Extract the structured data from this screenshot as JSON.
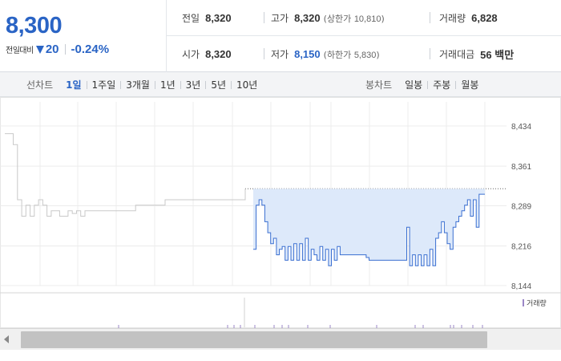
{
  "summary": {
    "current_price": "8,300",
    "change_label": "전일대비",
    "change_direction": "down",
    "change_amount": "20",
    "change_percent": "-0.24%",
    "down_color": "#2a64c5",
    "stats": {
      "prev_close": {
        "label": "전일",
        "value": "8,320"
      },
      "open": {
        "label": "시가",
        "value": "8,320"
      },
      "high": {
        "label": "고가",
        "value": "8,320",
        "limit_label": "상한가",
        "limit_value": "10,810"
      },
      "low": {
        "label": "저가",
        "value": "8,150",
        "limit_label": "하한가",
        "limit_value": "5,830"
      },
      "volume": {
        "label": "거래량",
        "value": "6,828"
      },
      "trade_value": {
        "label": "거래대금",
        "value": "56 백만"
      }
    }
  },
  "toolbar": {
    "line_chart_title": "선차트",
    "periods": [
      "1일",
      "1주일",
      "3개월",
      "1년",
      "3년",
      "5년",
      "10년"
    ],
    "active_period": "1일",
    "candle_chart_title": "봉차트",
    "candle_periods": [
      "일봉",
      "주봉",
      "월봉"
    ]
  },
  "chart_data": {
    "type": "line",
    "y_ticks": [
      "8,434",
      "8,361",
      "8,289",
      "8,216",
      "8,144"
    ],
    "ylim": [
      8144,
      8434
    ],
    "reference_line": 8320,
    "grid": true,
    "legend": "거래량",
    "series": [
      {
        "color": "#c9c9c9",
        "values": [
          8420,
          8420,
          8400,
          8300,
          8270,
          8290,
          8270,
          8290,
          8300,
          8290,
          8270,
          8280,
          8280,
          8270,
          8270,
          8280,
          8275,
          8280,
          8270,
          8280,
          8280,
          8280,
          8280,
          8280,
          8280,
          8280,
          8280,
          8280,
          8280,
          8280,
          8280,
          8290,
          8290,
          8290,
          8290,
          8290,
          8290,
          8290,
          8300,
          8300,
          8300,
          8300,
          8300,
          8300,
          8300,
          8300,
          8300,
          8300,
          8300,
          8300,
          8300,
          8300,
          8300,
          8300,
          8300,
          8300,
          8300,
          8320
        ]
      },
      {
        "color": "#3a6fd1",
        "area_fill": "#dde9fa",
        "values": [
          8210,
          8290,
          8300,
          8290,
          8260,
          8240,
          8220,
          8230,
          8200,
          8210,
          8215,
          8190,
          8215,
          8190,
          8220,
          8190,
          8220,
          8190,
          8230,
          8190,
          8210,
          8200,
          8190,
          8215,
          8190,
          8210,
          8180,
          8210,
          8190,
          8215,
          8200,
          8200,
          8200,
          8200,
          8200,
          8200,
          8200,
          8200,
          8200,
          8195,
          8190,
          8190,
          8190,
          8190,
          8190,
          8190,
          8190,
          8190,
          8190,
          8190,
          8190,
          8190,
          8190,
          8250,
          8180,
          8200,
          8180,
          8200,
          8180,
          8200,
          8180,
          8210,
          8180,
          8230,
          8240,
          8260,
          8240,
          8220,
          8210,
          8250,
          8260,
          8270,
          8280,
          8290,
          8300,
          8270,
          8300,
          8250,
          8310,
          8310,
          8310
        ]
      }
    ]
  }
}
